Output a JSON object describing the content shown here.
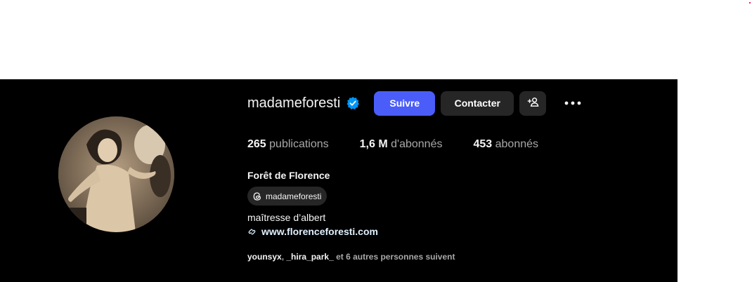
{
  "profile": {
    "username": "madameforesti",
    "full_name": "Forêt de Florence",
    "threads_handle": "madameforesti",
    "bio": "maîtresse d’albert",
    "website": "www.florenceforesti.com"
  },
  "actions": {
    "follow_label": "Suivre",
    "contact_label": "Contacter",
    "follow_color": "#4a5df9",
    "secondary_color": "#262626"
  },
  "stats": {
    "posts_count": "265",
    "posts_label": "publications",
    "followers_count": "1,6 M",
    "followers_label": "d'abonnés",
    "following_count": "453",
    "following_label": "abonnés"
  },
  "followed_by": {
    "user1": "younsyx",
    "separator": ", ",
    "user2": "_hira_park_",
    "rest": " et 6 autres personnes suivent"
  },
  "icons": {
    "verified": "verified-badge-icon",
    "suggest": "person-add-icon",
    "more": "more-horizontal-icon",
    "threads": "threads-logo-icon",
    "link": "link-icon"
  },
  "colors": {
    "verified_blue": "#0095f6",
    "panel_bg": "#000000",
    "secondary_text": "#a8a8a8"
  }
}
